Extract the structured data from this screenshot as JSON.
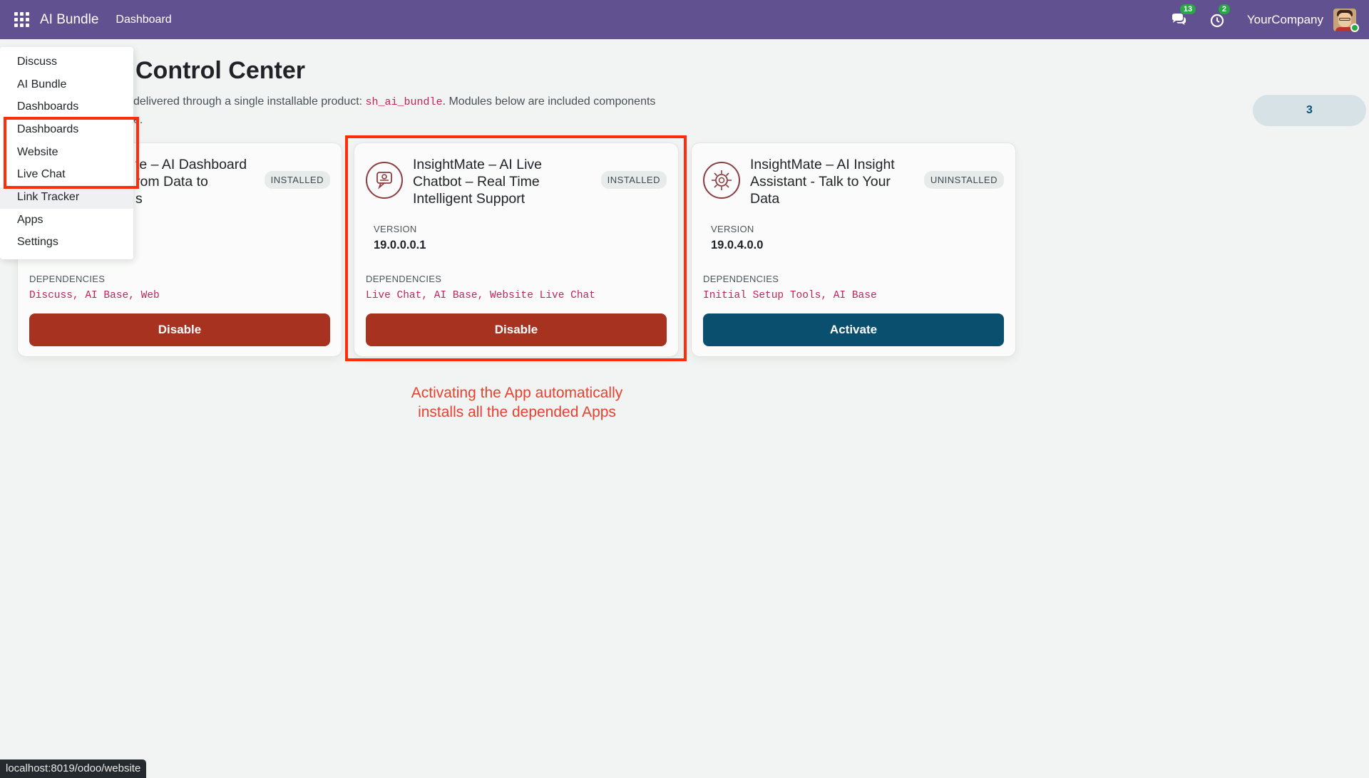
{
  "navbar": {
    "brand": "AI Bundle",
    "link": "Dashboard",
    "messages_count": "13",
    "activities_count": "2",
    "company": "YourCompany"
  },
  "page": {
    "title": "Control Center",
    "subtitle_prefix": "delivered through a single installable product:",
    "product_code": "sh_ai_bundle",
    "subtitle_suffix": ". Modules below are included components",
    "subtitle_line2_fragment": "e.",
    "count": "3"
  },
  "menu": {
    "items": [
      "Discuss",
      "AI Bundle",
      "Dashboards",
      "Dashboards",
      "Website",
      "Live Chat",
      "Link Tracker",
      "Apps",
      "Settings"
    ]
  },
  "cards": [
    {
      "title_line1": "te – AI Dashboard",
      "title_line2": "rom Data to",
      "title_line3": "s",
      "status": "INSTALLED",
      "deps_label": "DEPENDENCIES",
      "deps": "Discuss, AI Base, Web",
      "button": "Disable"
    },
    {
      "title_line1": "InsightMate – AI Live",
      "title_line2": "Chatbot – Real Time",
      "title_line3": "Intelligent Support",
      "status": "INSTALLED",
      "version_label": "VERSION",
      "version": "19.0.0.0.1",
      "deps_label": "DEPENDENCIES",
      "deps": "Live Chat, AI Base, Website Live Chat",
      "button": "Disable"
    },
    {
      "title_line1": "InsightMate – AI Insight",
      "title_line2": "Assistant - Talk to Your",
      "title_line3": "Data",
      "status": "UNINSTALLED",
      "version_label": "VERSION",
      "version": "19.0.4.0.0",
      "deps_label": "DEPENDENCIES",
      "deps": "Initial Setup Tools, AI Base",
      "button": "Activate"
    }
  ],
  "annotation": {
    "line1": "Activating the App automatically",
    "line2": "installs all the depended Apps",
    "color": "#e8412f"
  },
  "status_url": "localhost:8019/odoo/website",
  "colors": {
    "navbar": "#625191",
    "disable": "#a83220",
    "activate": "#0b4f6e",
    "highlight": "#ff2d0a",
    "code": "#c0245c"
  }
}
